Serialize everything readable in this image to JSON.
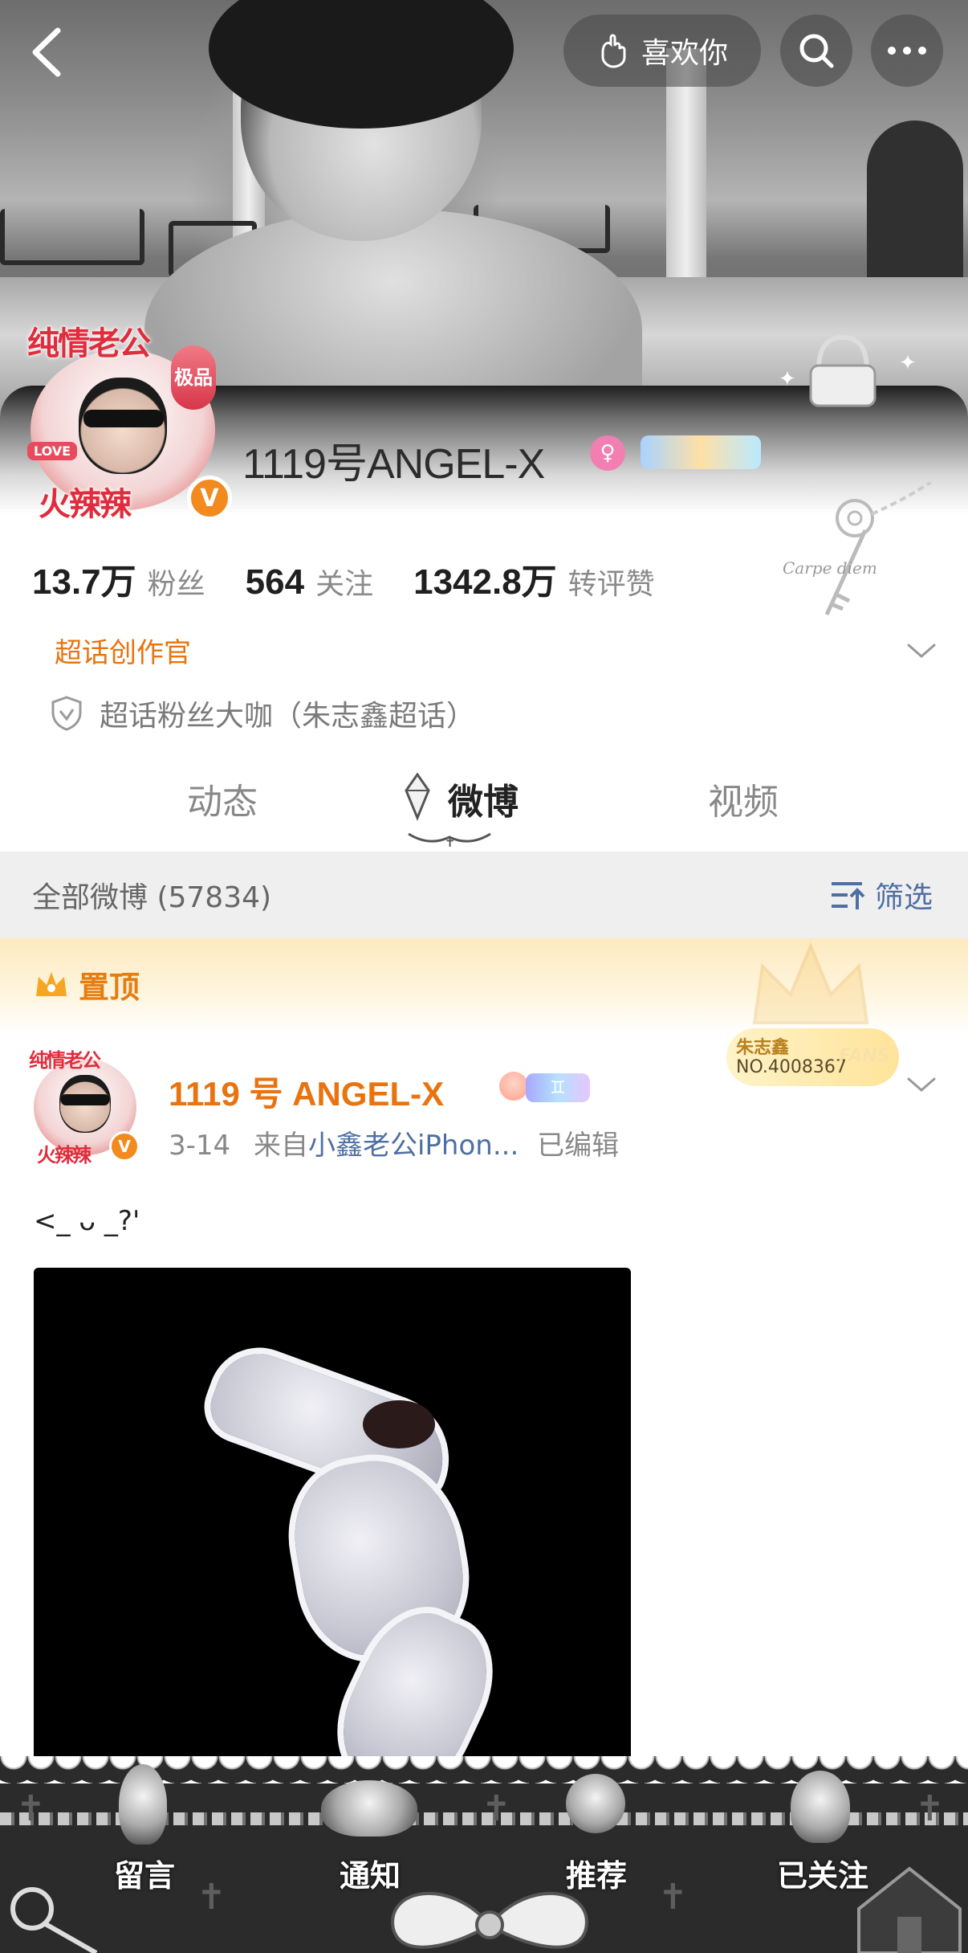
{
  "header": {
    "like_label": "喜欢你"
  },
  "avatar": {
    "top_text": "纯情老公",
    "badge_text": "极品",
    "love_tag": "LOVE",
    "bottom_text": "火辣辣",
    "verify": "V"
  },
  "profile": {
    "username": "1119号ANGEL-X",
    "decor_text": "Carpe diem",
    "stats": [
      {
        "num": "13.7万",
        "label": "粉丝"
      },
      {
        "num": "564",
        "label": "关注"
      },
      {
        "num": "1342.8万",
        "label": "转评赞"
      }
    ],
    "creator_badge": "超话创作官",
    "fan_title": "超话粉丝大咖（朱志鑫超话）"
  },
  "tabs": [
    {
      "label": "动态"
    },
    {
      "label": "微博"
    },
    {
      "label": "视频"
    }
  ],
  "filter": {
    "title": "全部微博 (57834)",
    "button": "筛选"
  },
  "pinned": {
    "label": "置顶"
  },
  "post": {
    "name": "1119 号 ANGEL-X",
    "badge": "♊",
    "date": "3-14",
    "from_prefix": "来自",
    "source": "小鑫老公iPhon...",
    "edited": "已编辑",
    "text": "<_ ᴗ _?'",
    "fans_card": {
      "name": "朱志鑫",
      "number": "NO.4008367",
      "tag": "FANS"
    }
  },
  "bottom_nav": [
    {
      "label": "留言"
    },
    {
      "label": "通知"
    },
    {
      "label": "推荐"
    },
    {
      "label": "已关注"
    }
  ],
  "colors": {
    "accent_orange": "#e8730f",
    "link_blue": "#4e6fa3",
    "verify_orange": "#f28a1e"
  }
}
